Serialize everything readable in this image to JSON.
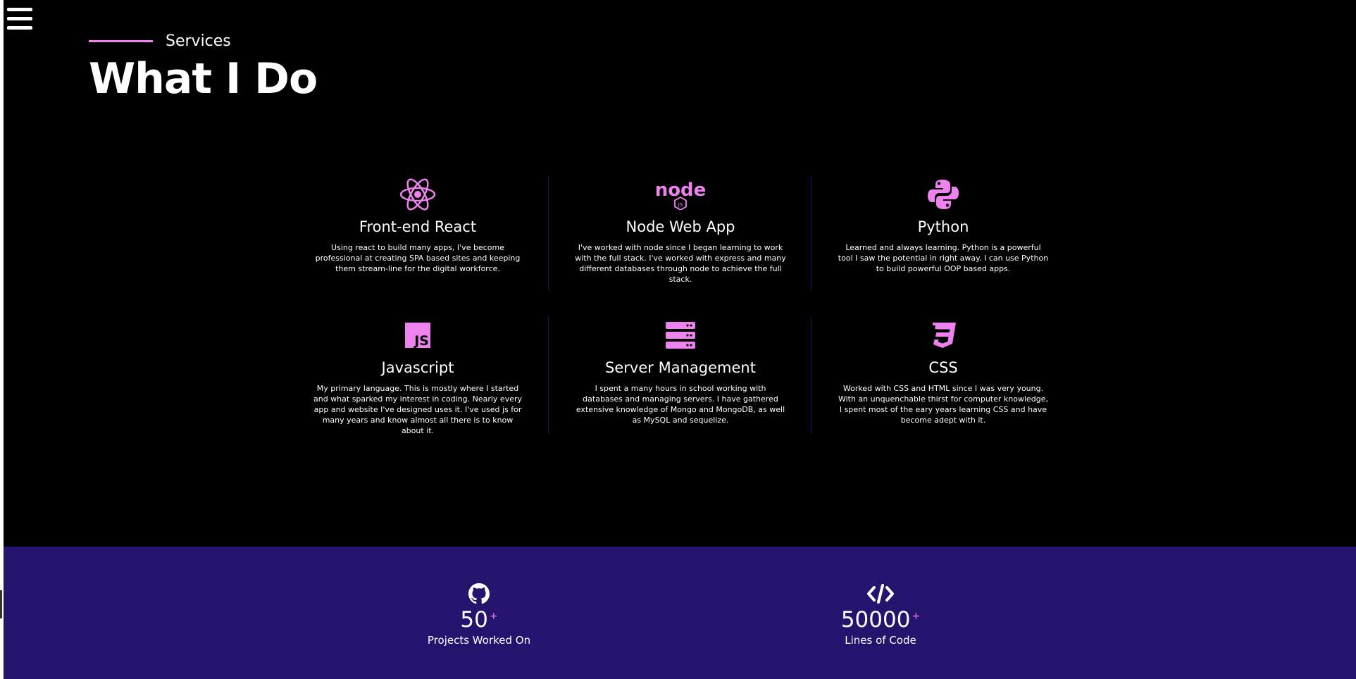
{
  "colors": {
    "accent": "#ee82ee",
    "stats_bg": "#25136d",
    "background": "#000000",
    "divider": "#1c1660"
  },
  "menu": {
    "icon": "hamburger-menu-icon"
  },
  "header": {
    "eyebrow": "Services",
    "title": "What I Do"
  },
  "services": [
    {
      "icon": "react-icon",
      "title": "Front-end React",
      "description": "Using react to build many apps, I've become professional at creating SPA based sites and keeping them stream-line for the digital workforce."
    },
    {
      "icon": "nodejs-icon",
      "title": "Node Web App",
      "description": "I've worked with node since I began learning to work with the full stack. I've worked with express and many different databases through node to achieve the full stack."
    },
    {
      "icon": "python-icon",
      "title": "Python",
      "description": "Learned and always learning. Python is a powerful tool I saw the potential in right away. I can use Python to build powerful OOP based apps."
    },
    {
      "icon": "javascript-icon",
      "title": "Javascript",
      "description": "My primary language. This is mostly where I started and what sparked my interest in coding. Nearly every app and website I've designed uses it. I've used js for many years and know almost all there is to know about it."
    },
    {
      "icon": "server-icon",
      "title": "Server Management",
      "description": "I spent a many hours in school working with databases and managing servers. I have gathered extensive knowledge of Mongo and MongoDB, as well as MySQL and sequelize."
    },
    {
      "icon": "css3-icon",
      "title": "CSS",
      "description": "Worked with CSS and HTML since I was very young. With an unquenchable thirst for computer knowledge, I spent most of the eary years learning CSS and have become adept with it."
    }
  ],
  "stats": [
    {
      "icon": "github-icon",
      "number": "50",
      "suffix": "+",
      "label": "Projects Worked On"
    },
    {
      "icon": "code-icon",
      "number": "50000",
      "suffix": "+",
      "label": "Lines of Code"
    }
  ]
}
